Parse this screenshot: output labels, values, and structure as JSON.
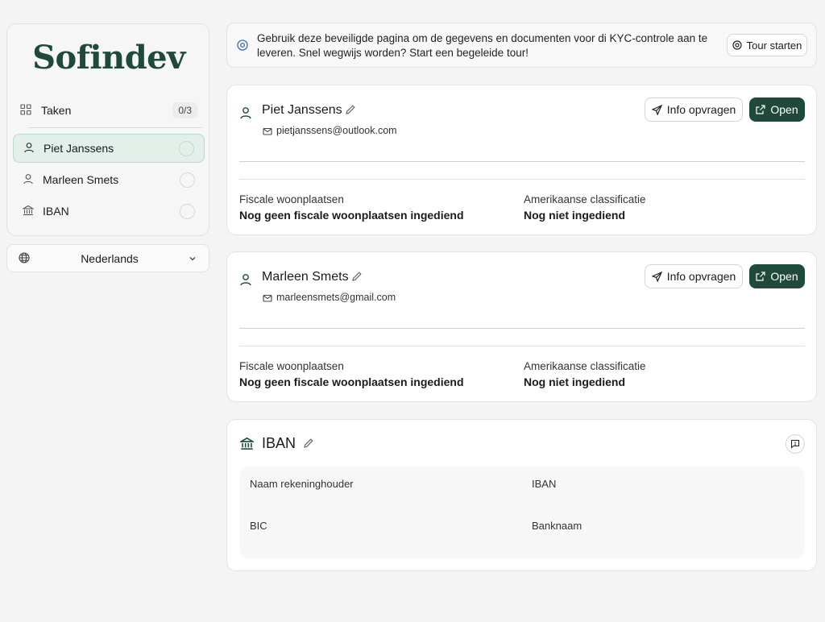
{
  "sidebar": {
    "logo": "Sofindev",
    "tasks": {
      "label": "Taken",
      "badge": "0/3"
    },
    "items": [
      {
        "label": "Piet Janssens",
        "icon": "user-icon",
        "active": true
      },
      {
        "label": "Marleen Smets",
        "icon": "user-icon",
        "active": false
      },
      {
        "label": "IBAN",
        "icon": "bank-icon",
        "active": false
      }
    ],
    "language": {
      "label": "Nederlands",
      "icon": "globe-icon"
    }
  },
  "banner": {
    "text": "Gebruik deze beveiligde pagina om de gegevens en documenten voor di KYC-controle aan te leveren. Snel wegwijs worden? Start een begeleide tour!",
    "tour_button": "Tour starten"
  },
  "persons": [
    {
      "name": "Piet Janssens",
      "email": "pietjanssens@outlook.com",
      "info_button": "Info opvragen",
      "open_button": "Open",
      "fiscal_label": "Fiscale woonplaatsen",
      "fiscal_value": "Nog geen fiscale woonplaatsen ingediend",
      "us_label": "Amerikaanse classificatie",
      "us_value": "Nog niet ingediend"
    },
    {
      "name": "Marleen Smets",
      "email": "marleensmets@gmail.com",
      "info_button": "Info opvragen",
      "open_button": "Open",
      "fiscal_label": "Fiscale woonplaatsen",
      "fiscal_value": "Nog geen fiscale woonplaatsen ingediend",
      "us_label": "Amerikaanse classificatie",
      "us_value": "Nog niet ingediend"
    }
  ],
  "iban": {
    "title": "IBAN",
    "account_holder_label": "Naam rekeninghouder",
    "iban_label": "IBAN",
    "bic_label": "BIC",
    "bank_name_label": "Banknaam"
  },
  "colors": {
    "brand": "#1f4a3a",
    "active_bg": "#e3efe9",
    "page_bg": "#f4f4f4"
  }
}
